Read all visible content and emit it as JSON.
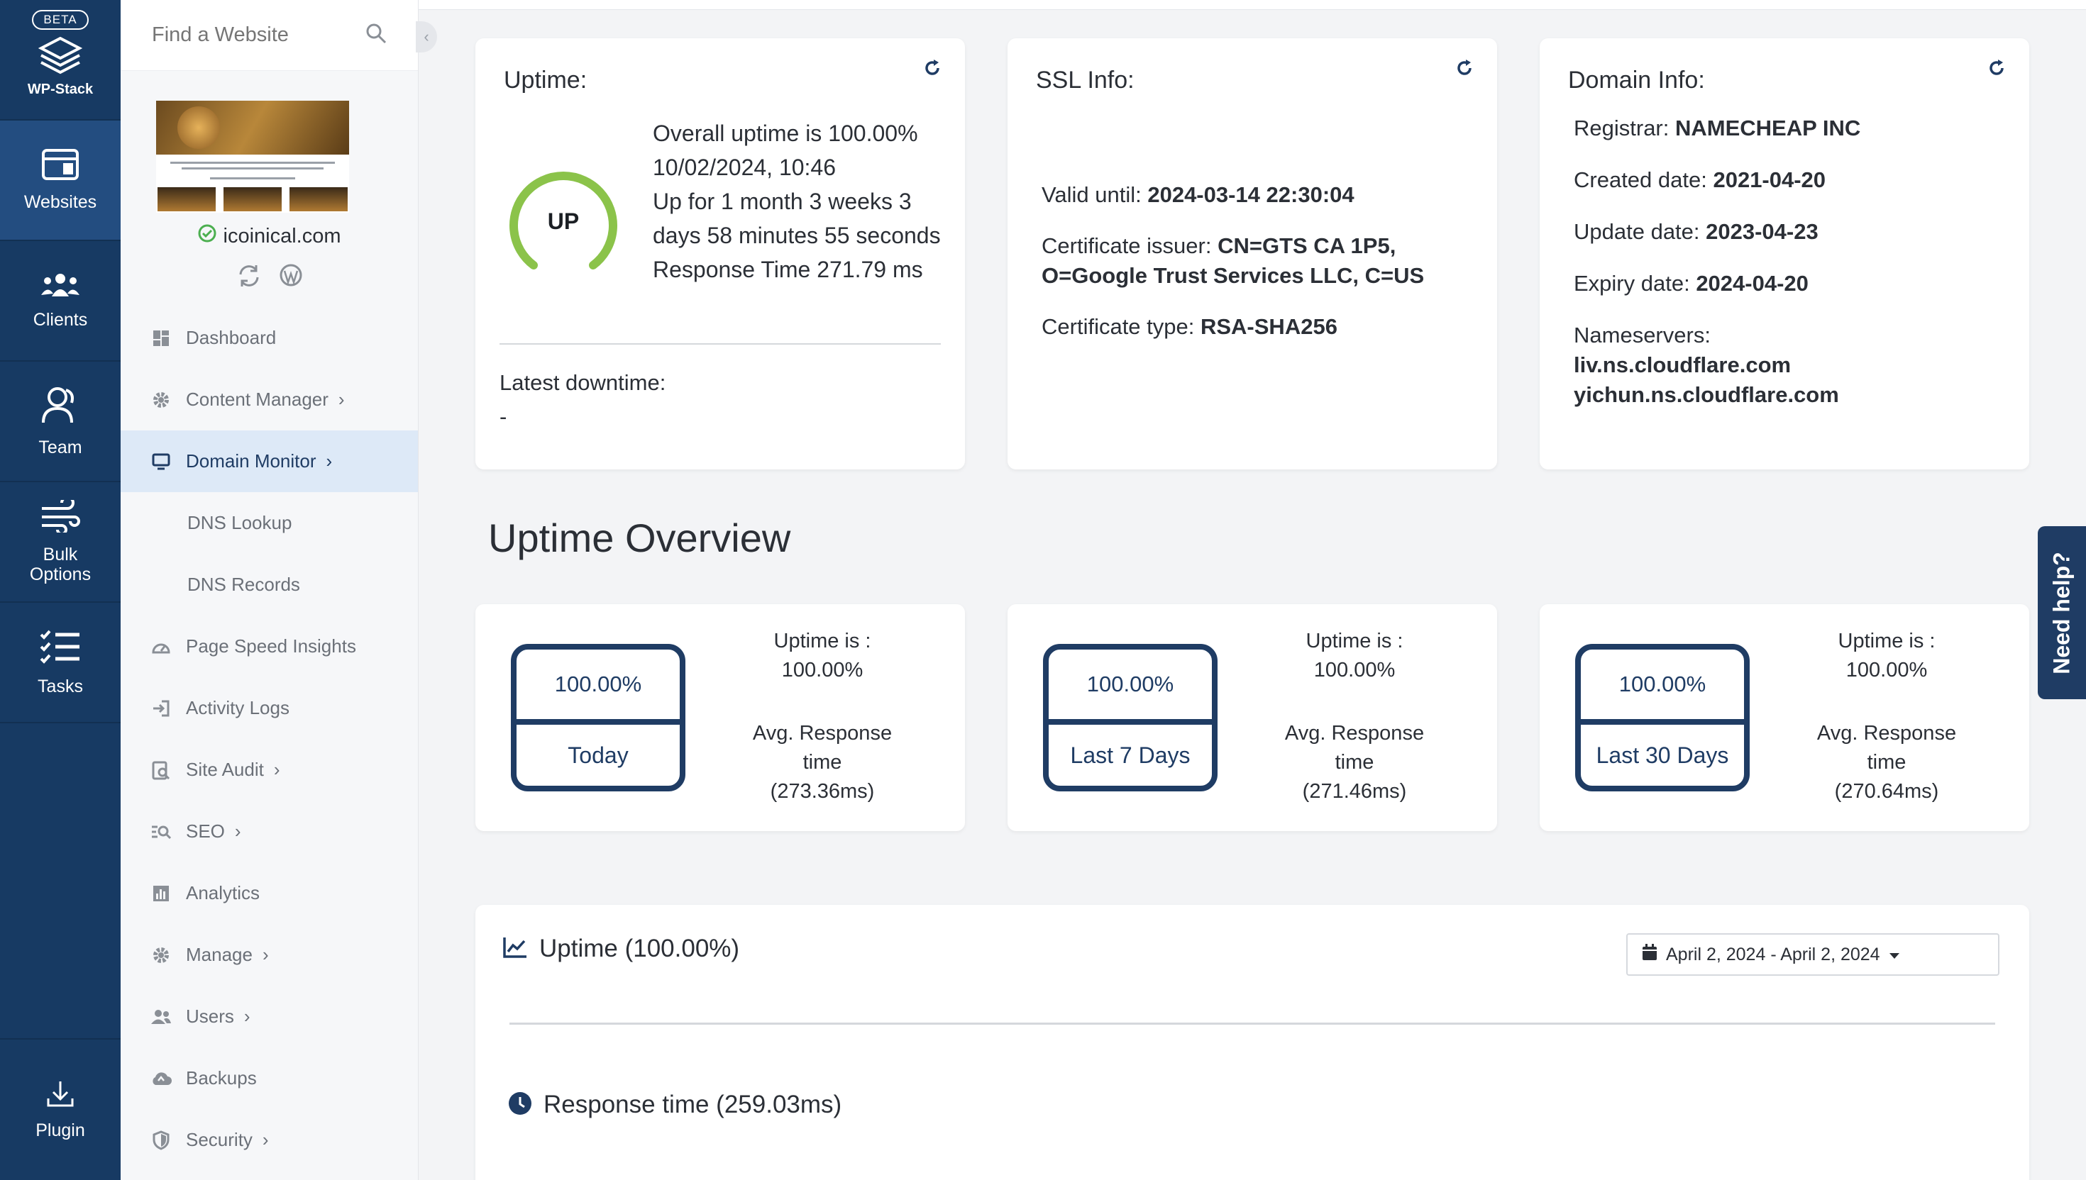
{
  "rail": {
    "beta": "BETA",
    "brand": "WP-Stack",
    "items": [
      {
        "label": "Websites"
      },
      {
        "label": "Clients"
      },
      {
        "label": "Team"
      },
      {
        "label": "Bulk Options"
      },
      {
        "label": "Tasks"
      }
    ],
    "plugin": "Plugin"
  },
  "sidebar": {
    "search_placeholder": "Find a Website",
    "site_name": "icoinical.com",
    "menu": [
      {
        "label": "Dashboard"
      },
      {
        "label": "Content Manager"
      },
      {
        "label": "Domain Monitor"
      },
      {
        "label": "DNS Lookup"
      },
      {
        "label": "DNS Records"
      },
      {
        "label": "Page Speed Insights"
      },
      {
        "label": "Activity Logs"
      },
      {
        "label": "Site Audit"
      },
      {
        "label": "SEO"
      },
      {
        "label": "Analytics"
      },
      {
        "label": "Manage"
      },
      {
        "label": "Users"
      },
      {
        "label": "Backups"
      },
      {
        "label": "Security"
      }
    ]
  },
  "uptime": {
    "title": "Uptime:",
    "status": "UP",
    "overall": "Overall uptime is 100.00%",
    "datetime": "10/02/2024, 10:46",
    "up_for": "Up for 1 month 3 weeks 3 days 58 minutes 55 seconds",
    "response": "Response Time 271.79 ms",
    "latest_downtime_label": "Latest downtime:",
    "latest_downtime_value": "-"
  },
  "ssl": {
    "title": "SSL Info:",
    "valid_label": "Valid until: ",
    "valid_value": "2024-03-14 22:30:04",
    "issuer_label": "Certificate issuer: ",
    "issuer_value": "CN=GTS CA 1P5, O=Google Trust Services LLC, C=US",
    "type_label": "Certificate type: ",
    "type_value": "RSA-SHA256"
  },
  "domain": {
    "title": "Domain Info:",
    "registrar_label": "Registrar: ",
    "registrar_value": "NAMECHEAP INC",
    "created_label": "Created date: ",
    "created_value": "2021-04-20",
    "updated_label": "Update date: ",
    "updated_value": "2023-04-23",
    "expiry_label": "Expiry date: ",
    "expiry_value": "2024-04-20",
    "nameservers_label": "Nameservers:",
    "ns1": "liv.ns.cloudflare.com",
    "ns2": "yichun.ns.cloudflare.com"
  },
  "overview": {
    "title": "Uptime Overview",
    "cards": [
      {
        "pct": "100.00%",
        "period": "Today",
        "uptime_label": "Uptime is :",
        "uptime_value": "100.00%",
        "avg_label": "Avg. Response time",
        "avg_value": "(273.36ms)"
      },
      {
        "pct": "100.00%",
        "period": "Last 7 Days",
        "uptime_label": "Uptime is :",
        "uptime_value": "100.00%",
        "avg_label": "Avg. Response time",
        "avg_value": "(271.46ms)"
      },
      {
        "pct": "100.00%",
        "period": "Last 30 Days",
        "uptime_label": "Uptime is :",
        "uptime_value": "100.00%",
        "avg_label": "Avg. Response time",
        "avg_value": "(270.64ms)"
      }
    ]
  },
  "chart_panel": {
    "uptime_title": "Uptime (100.00%)",
    "date_range": "April 2, 2024 - April 2, 2024",
    "response_title": "Response time (259.03ms)"
  },
  "help": "Need help?",
  "colors": {
    "navy": "#1f3c64",
    "rail": "#173a63",
    "green": "#8bc34a"
  }
}
